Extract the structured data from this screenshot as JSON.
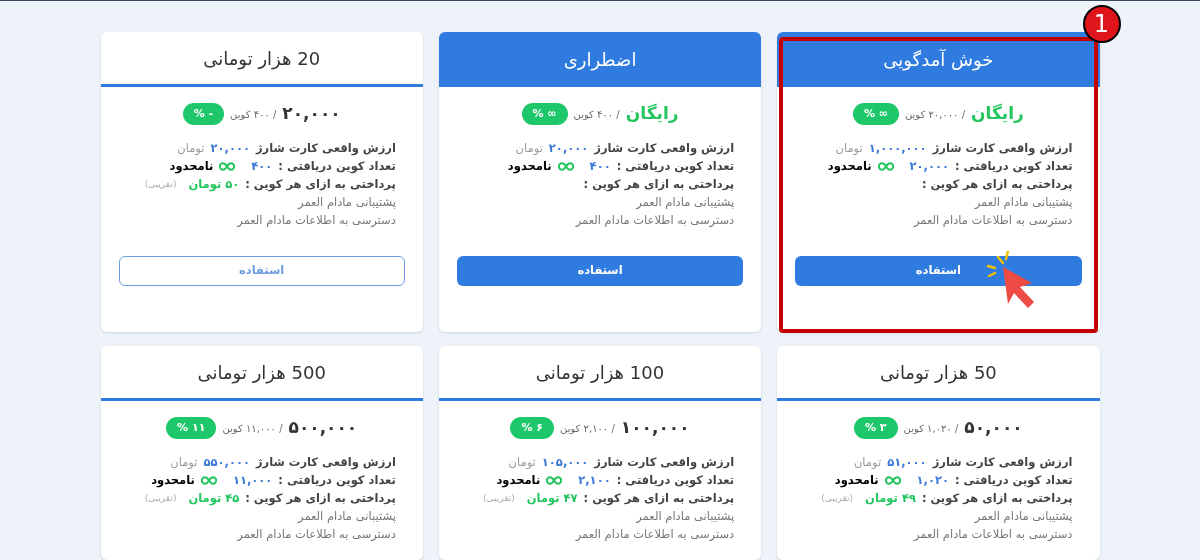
{
  "cards": [
    {
      "title": "خوش آمدگویی",
      "kind": "free",
      "highlighted": true,
      "marker": "1",
      "price": "رایگان",
      "coins": "/ ۲۰,۰۰۰ کوین",
      "badge": "∞ %",
      "real_value_label": "ارزش واقعی کارت شارژ",
      "real_value": "۱,۰۰۰,۰۰۰",
      "real_value_unit": "تومان",
      "coin_count_label": "تعداد کوین دریافتی :",
      "coin_count": "۲۰,۰۰۰",
      "validity": "نامحدود",
      "per_coin_label": "پرداختی به ازای هر کوین :",
      "features": [
        "پشتیبانی مادام العمر",
        "دسترسی به اطلاعات مادام العمر"
      ],
      "button": {
        "label": "استفاده",
        "kind": "filled"
      }
    },
    {
      "title": "اضطراری",
      "kind": "free",
      "highlighted": false,
      "price": "رایگان",
      "coins": "/ ۴۰۰ کوین",
      "badge": "∞ %",
      "real_value_label": "ارزش واقعی کارت شارژ",
      "real_value": "۲۰,۰۰۰",
      "real_value_unit": "تومان",
      "coin_count_label": "تعداد کوین دریافتی :",
      "coin_count": "۴۰۰",
      "validity": "نامحدود",
      "per_coin_label": "پرداختی به ازای هر کوین :",
      "features": [
        "پشتیبانی مادام العمر",
        "دسترسی به اطلاعات مادام العمر"
      ],
      "button": {
        "label": "استفاده",
        "kind": "filled"
      }
    },
    {
      "title": "20 هزار تومانی",
      "kind": "paid",
      "highlighted": false,
      "price": "۲۰,۰۰۰",
      "coins": "/ ۴۰۰ کوین",
      "badge": "- %",
      "real_value_label": "ارزش واقعی کارت شارژ",
      "real_value": "۲۰,۰۰۰",
      "real_value_unit": "تومان",
      "coin_count_label": "تعداد کوین دریافتی :",
      "coin_count": "۴۰۰",
      "validity": "نامحدود",
      "per_coin_label": "پرداختی به ازای هر کوین :",
      "per_coin": "۵۰ تومان",
      "per_coin_note": "(تقریبی)",
      "features": [
        "پشتیبانی مادام العمر",
        "دسترسی به اطلاعات مادام العمر"
      ],
      "button": {
        "label": "استفاده",
        "kind": "outline"
      }
    },
    {
      "title": "50 هزار تومانی",
      "kind": "paid",
      "highlighted": false,
      "price": "۵۰,۰۰۰",
      "coins": "/ ۱,۰۲۰ کوین",
      "badge": "۳ %",
      "real_value_label": "ارزش واقعی کارت شارژ",
      "real_value": "۵۱,۰۰۰",
      "real_value_unit": "تومان",
      "coin_count_label": "تعداد کوین دریافتی :",
      "coin_count": "۱,۰۲۰",
      "validity": "نامحدود",
      "per_coin_label": "پرداختی به ازای هر کوین :",
      "per_coin": "۴۹ تومان",
      "per_coin_note": "(تقریبی)",
      "features": [
        "پشتیبانی مادام العمر",
        "دسترسی به اطلاعات مادام العمر"
      ]
    },
    {
      "title": "100 هزار تومانی",
      "kind": "paid",
      "highlighted": false,
      "price": "۱۰۰,۰۰۰",
      "coins": "/ ۲,۱۰۰ کوین",
      "badge": "۶ %",
      "real_value_label": "ارزش واقعی کارت شارژ",
      "real_value": "۱۰۵,۰۰۰",
      "real_value_unit": "تومان",
      "coin_count_label": "تعداد کوین دریافتی :",
      "coin_count": "۲,۱۰۰",
      "validity": "نامحدود",
      "per_coin_label": "پرداختی به ازای هر کوین :",
      "per_coin": "۴۷ تومان",
      "per_coin_note": "(تقریبی)",
      "features": [
        "پشتیبانی مادام العمر",
        "دسترسی به اطلاعات مادام العمر"
      ]
    },
    {
      "title": "500 هزار تومانی",
      "kind": "paid",
      "highlighted": false,
      "price": "۵۰۰,۰۰۰",
      "coins": "/ ۱۱,۰۰۰ کوین",
      "badge": "۱۱ %",
      "real_value_label": "ارزش واقعی کارت شارژ",
      "real_value": "۵۵۰,۰۰۰",
      "real_value_unit": "تومان",
      "coin_count_label": "تعداد کوین دریافتی :",
      "coin_count": "۱۱,۰۰۰",
      "validity": "نامحدود",
      "per_coin_label": "پرداختی به ازای هر کوین :",
      "per_coin": "۴۵ تومان",
      "per_coin_note": "(تقریبی)",
      "features": [
        "پشتیبانی مادام العمر",
        "دسترسی به اطلاعات مادام العمر"
      ]
    }
  ]
}
